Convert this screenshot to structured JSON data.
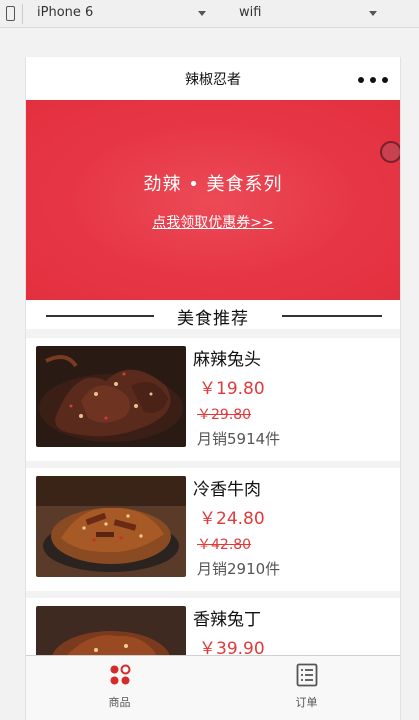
{
  "simulator": {
    "device": "iPhone 6",
    "network": "wifi"
  },
  "nav": {
    "title": "辣椒忍者"
  },
  "banner": {
    "title": "劲辣 • 美食系列",
    "coupon_link": "点我领取优惠券>>",
    "bg_color": "#e63646"
  },
  "section": {
    "title": "美食推荐"
  },
  "products": [
    {
      "name": "麻辣兔头",
      "price": "￥19.80",
      "original_price": "￥29.80",
      "sales": "月销5914件",
      "image": "braised-rabbit-head-photo"
    },
    {
      "name": "冷香牛肉",
      "price": "￥24.80",
      "original_price": "￥42.80",
      "sales": "月销2910件",
      "image": "spicy-beef-photo"
    },
    {
      "name": "香辣兔丁",
      "price": "￥39.90",
      "original_price": "",
      "sales": "",
      "image": "spicy-rabbit-dice-photo"
    }
  ],
  "tabbar": {
    "tabs": [
      {
        "label": "商品",
        "icon": "grid-dots-icon",
        "color": "#d62a2a",
        "active": true
      },
      {
        "label": "订单",
        "icon": "order-list-icon",
        "color": "#555555",
        "active": false
      }
    ]
  },
  "colors": {
    "accent": "#e63646",
    "price": "#e23a3a"
  }
}
